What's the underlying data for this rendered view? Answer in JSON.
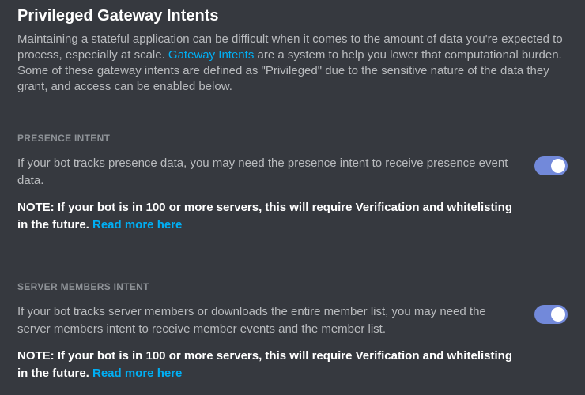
{
  "header": {
    "title": "Privileged Gateway Intents",
    "intro_before_link": "Maintaining a stateful application can be difficult when it comes to the amount of data you're expected to process, especially at scale. ",
    "intro_link_text": "Gateway Intents",
    "intro_after_link": " are a system to help you lower that computational burden. Some of these gateway intents are defined as \"Privileged\" due to the sensitive nature of the data they grant, and access can be enabled below."
  },
  "sections": {
    "presence": {
      "label": "PRESENCE INTENT",
      "description": "If your bot tracks presence data, you may need the presence intent to receive presence event data.",
      "note_prefix": "NOTE: If your bot is in 100 or more servers, this will require Verification and whitelisting in the future. ",
      "note_link": "Read more here",
      "toggle_on": true
    },
    "members": {
      "label": "SERVER MEMBERS INTENT",
      "description": "If your bot tracks server members or downloads the entire member list, you may need the server members intent to receive member events and the member list.",
      "note_prefix": "NOTE: If your bot is in 100 or more servers, this will require Verification and whitelisting in the future. ",
      "note_link": "Read more here",
      "toggle_on": true
    }
  }
}
